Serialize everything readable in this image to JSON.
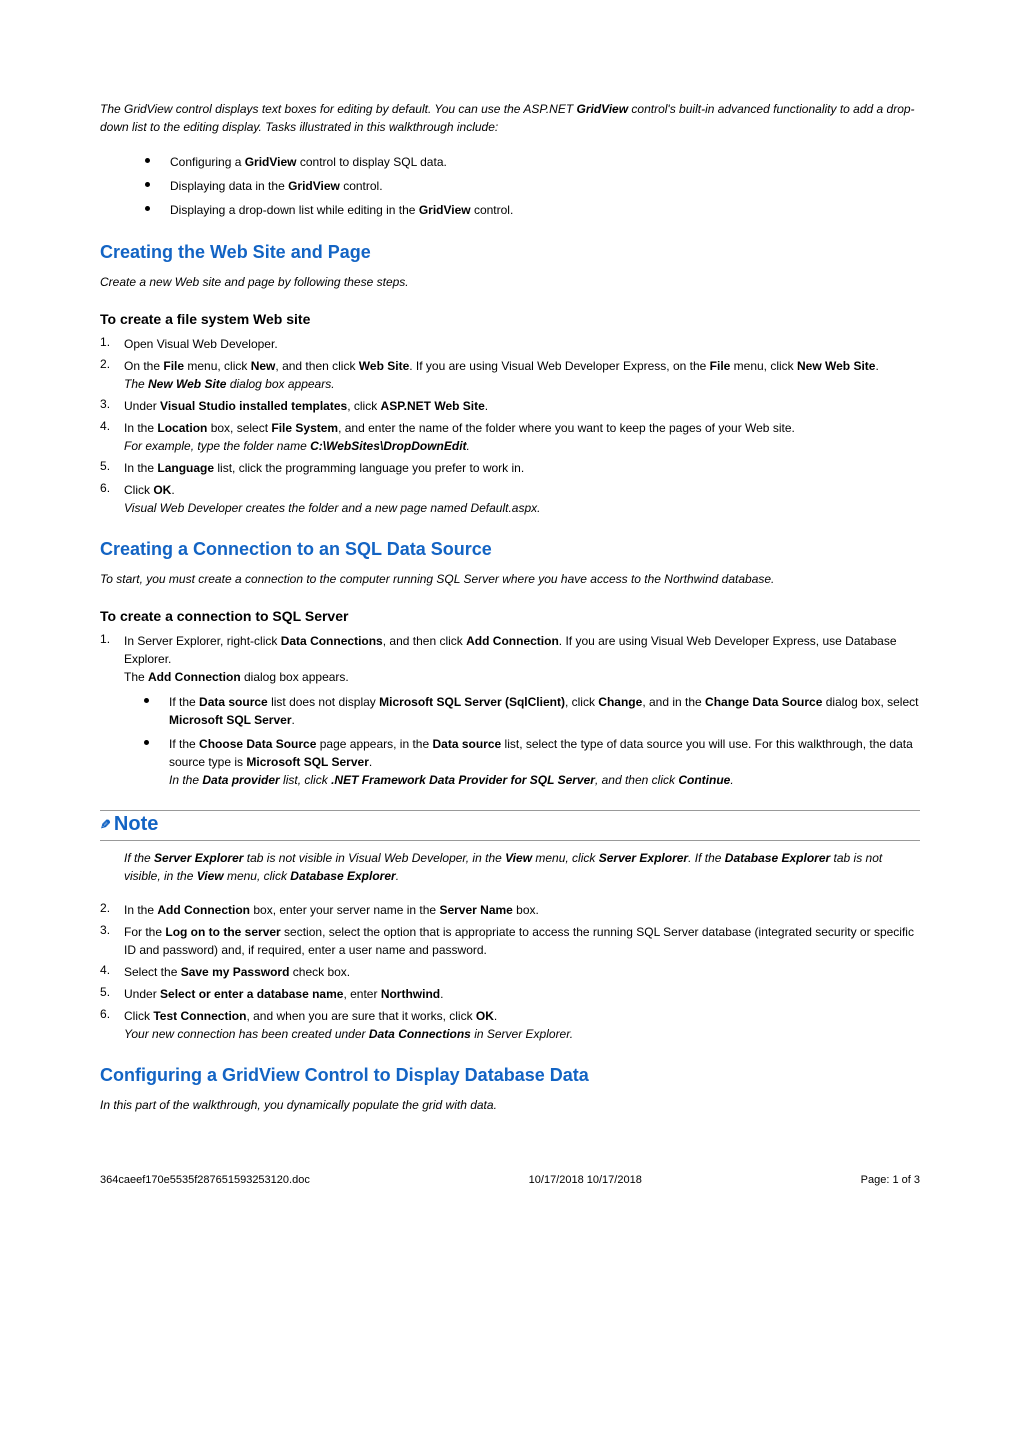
{
  "intro_prefix": "The GridView control displays text boxes for editing by default. You can use the ASP.NET ",
  "intro_bold": "GridView",
  "intro_suffix": " control's built-in advanced functionality to add a drop-down list to the editing display. Tasks illustrated in this walkthrough include:",
  "tasks": [
    {
      "pre": "Configuring a ",
      "bold": "GridView",
      "post": " control to display SQL data."
    },
    {
      "pre": "Displaying data in the ",
      "bold": "GridView",
      "post": " control."
    },
    {
      "pre": "Displaying a drop-down list while editing in the ",
      "bold": "GridView",
      "post": " control."
    }
  ],
  "section1": {
    "title": "Creating the Web Site and Page",
    "desc": "Create a new Web site and page by following these steps.",
    "subtitle": "To create a file system Web site",
    "steps": [
      {
        "text": "Open Visual Web Developer."
      },
      {
        "parts": [
          {
            "t": "On the "
          },
          {
            "b": "File"
          },
          {
            "t": " menu, click "
          },
          {
            "b": "New"
          },
          {
            "t": ", and then click "
          },
          {
            "b": "Web Site"
          },
          {
            "t": ". If you are using Visual Web Developer Express, on the "
          },
          {
            "b": "File"
          },
          {
            "t": " menu, click "
          },
          {
            "b": "New Web Site"
          },
          {
            "t": "."
          }
        ],
        "after": [
          {
            "i_pre": "The ",
            "ib": "New Web Site",
            "i_post": " dialog box appears."
          }
        ]
      },
      {
        "parts": [
          {
            "t": "Under "
          },
          {
            "b": "Visual Studio installed templates"
          },
          {
            "t": ", click "
          },
          {
            "b": "ASP.NET Web Site"
          },
          {
            "t": "."
          }
        ]
      },
      {
        "parts": [
          {
            "t": "In the "
          },
          {
            "b": "Location"
          },
          {
            "t": " box, select "
          },
          {
            "b": "File System"
          },
          {
            "t": ", and enter the name of the folder where you want to keep the pages of your Web site."
          }
        ],
        "after": [
          {
            "i_pre": "For example, type the folder name ",
            "ib": "C:\\WebSites\\DropDownEdit",
            "i_post": "."
          }
        ]
      },
      {
        "parts": [
          {
            "t": "In the "
          },
          {
            "b": "Language"
          },
          {
            "t": " list, click the programming language you prefer to work in."
          }
        ]
      },
      {
        "parts": [
          {
            "t": "Click "
          },
          {
            "b": "OK"
          },
          {
            "t": "."
          }
        ],
        "after": [
          {
            "i_pre": "Visual Web Developer creates the folder and a new page named Default.aspx.",
            "ib": "",
            "i_post": ""
          }
        ]
      }
    ]
  },
  "section2": {
    "title": "Creating a Connection to an SQL Data Source",
    "desc": "To start, you must create a connection to the computer running SQL Server where you have access to the Northwind database.",
    "subtitle": "To create a connection to SQL Server",
    "step1": {
      "parts": [
        {
          "t": "In Server Explorer, right-click "
        },
        {
          "b": "Data Connections"
        },
        {
          "t": ", and then click "
        },
        {
          "b": "Add Connection"
        },
        {
          "t": ". If you are using Visual Web Developer Express, use Database Explorer."
        }
      ],
      "line2_parts": [
        {
          "t": "The "
        },
        {
          "b": "Add Connection"
        },
        {
          "t": " dialog box appears."
        }
      ],
      "sub_bullets": [
        {
          "parts": [
            {
              "t": "If the "
            },
            {
              "b": "Data source"
            },
            {
              "t": " list does not display "
            },
            {
              "b": "Microsoft SQL Server (SqlClient)"
            },
            {
              "t": ", click "
            },
            {
              "b": "Change"
            },
            {
              "t": ", and in the "
            },
            {
              "b": "Change Data Source"
            },
            {
              "t": " dialog box, select "
            },
            {
              "b": "Microsoft SQL Server"
            },
            {
              "t": "."
            }
          ]
        },
        {
          "parts": [
            {
              "t": "If the "
            },
            {
              "b": "Choose Data Source"
            },
            {
              "t": " page appears, in the "
            },
            {
              "b": "Data source"
            },
            {
              "t": " list, select the type of data source you will use. For this walkthrough, the data source type is "
            },
            {
              "b": "Microsoft SQL Server"
            },
            {
              "t": "."
            }
          ],
          "italic_after": {
            "pre": "In the ",
            "b1": "Data provider",
            "mid": " list, click ",
            "b2": ".NET Framework Data Provider for SQL Server",
            "mid2": ", and then click ",
            "b3": "Continue",
            "post": "."
          }
        }
      ]
    },
    "steps_rest": [
      {
        "parts": [
          {
            "t": "In the "
          },
          {
            "b": "Add Connection"
          },
          {
            "t": " box, enter your server name in the "
          },
          {
            "b": "Server Name"
          },
          {
            "t": " box."
          }
        ]
      },
      {
        "parts": [
          {
            "t": "For the "
          },
          {
            "b": "Log on to the server"
          },
          {
            "t": " section, select the option that is appropriate to access the running SQL Server database (integrated security or specific ID and password) and, if required, enter a user name and password."
          }
        ]
      },
      {
        "parts": [
          {
            "t": "Select the "
          },
          {
            "b": "Save my Password"
          },
          {
            "t": " check box."
          }
        ]
      },
      {
        "parts": [
          {
            "t": "Under "
          },
          {
            "b": "Select or enter a database name"
          },
          {
            "t": ", enter "
          },
          {
            "b": "Northwind"
          },
          {
            "t": "."
          }
        ]
      },
      {
        "parts": [
          {
            "t": "Click "
          },
          {
            "b": "Test Connection"
          },
          {
            "t": ", and when you are sure that it works, click "
          },
          {
            "b": "OK"
          },
          {
            "t": "."
          }
        ],
        "after": [
          {
            "i_pre": "Your new connection has been created under ",
            "ib": "Data Connections",
            "i_post": " in Server Explorer."
          }
        ]
      }
    ]
  },
  "note": {
    "label": "Note",
    "body_parts": [
      {
        "t": "If the "
      },
      {
        "b": "Server Explorer"
      },
      {
        "t": " tab is not visible in Visual Web Developer, in the "
      },
      {
        "b": "View"
      },
      {
        "t": " menu, click "
      },
      {
        "b": "Server Explorer"
      },
      {
        "t": ". If the "
      },
      {
        "b": "Database Explorer"
      },
      {
        "t": " tab is not visible, in the "
      },
      {
        "b": "View"
      },
      {
        "t": " menu, click "
      },
      {
        "b": "Database Explorer"
      },
      {
        "t": "."
      }
    ]
  },
  "section3": {
    "title": "Configuring a GridView Control to Display Database Data",
    "desc": "In this part of the walkthrough, you dynamically populate the grid with data."
  },
  "footer": {
    "left": "364caeef170e5535f287651593253120.doc",
    "center": "10/17/2018  10/17/2018",
    "right": "Page: 1 of 3"
  }
}
